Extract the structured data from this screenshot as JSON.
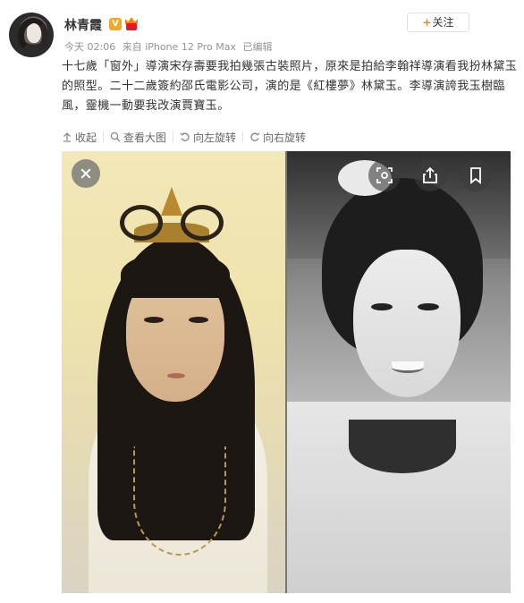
{
  "author": {
    "name": "林青霞",
    "verified_badge": "V"
  },
  "meta": {
    "time": "今天 02:06",
    "source": "来自 iPhone 12 Pro Max",
    "edited": "已编辑"
  },
  "follow_button": {
    "label": "关注",
    "icon": "plus-icon"
  },
  "post": {
    "text": "十七歲「窗外」導演宋存壽要我拍幾張古裝照片，原來是拍給李翰祥導演看我扮林黛玉的照型。二十二歲簽約邵氏電影公司，演的是《紅樓夢》林黛玉。李導演誇我玉樹臨風，靈機一動要我改演賈寶玉。"
  },
  "actions": [
    {
      "label": "收起",
      "icon": "collapse-arrow-icon"
    },
    {
      "label": "查看大图",
      "icon": "magnifier-icon"
    },
    {
      "label": "向左旋转",
      "icon": "rotate-left-icon"
    },
    {
      "label": "向右旋转",
      "icon": "rotate-right-icon"
    }
  ],
  "image_overlay": {
    "close": "close-icon",
    "scan": "scan-icon",
    "share": "share-icon",
    "bookmark": "bookmark-icon"
  },
  "colors": {
    "accent": "#ff8200",
    "verified": "#f5a623",
    "text": "#333333",
    "meta": "#939393"
  }
}
